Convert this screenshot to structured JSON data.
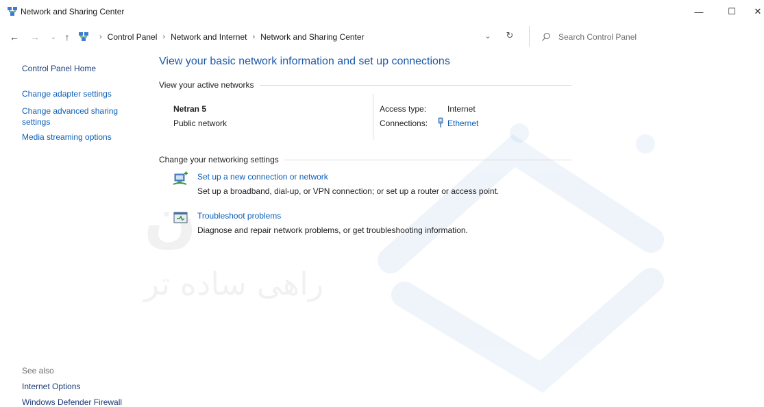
{
  "window": {
    "title": "Network and Sharing Center",
    "minimize": "—",
    "maximize": "☐",
    "close": "✕"
  },
  "address": {
    "back": "←",
    "forward": "→",
    "recent": "⌄",
    "up": "↑",
    "crumbs": [
      "Control Panel",
      "Network and Internet",
      "Network and Sharing Center"
    ],
    "separator": "›",
    "dropdown": "⌄",
    "refresh": "↻",
    "search_placeholder": "Search Control Panel"
  },
  "sidebar": {
    "home": "Control Panel Home",
    "items": [
      "Change adapter settings",
      "Change advanced sharing settings",
      "Media streaming options"
    ],
    "see_also_heading": "See also",
    "see_also": [
      "Internet Options",
      "Windows Defender Firewall"
    ]
  },
  "main": {
    "title": "View your basic network information and set up connections",
    "active_heading": "View your active networks",
    "network": {
      "name": "Netran 5",
      "type": "Public network",
      "access_label": "Access type:",
      "access_value": "Internet",
      "connections_label": "Connections:",
      "connections_value": "Ethernet"
    },
    "change_heading": "Change your networking settings",
    "tasks": [
      {
        "link": "Set up a new connection or network",
        "description": "Set up a broadband, dial-up, or VPN connection; or set up a router or access point."
      },
      {
        "link": "Troubleshoot problems",
        "description": "Diagnose and repair network problems, or get troubleshooting information."
      }
    ]
  },
  "watermark": {
    "text": "راهی ساده تر"
  },
  "colors": {
    "link": "#0b5eb8",
    "title": "#1c5aa8",
    "divider": "#dadada"
  }
}
